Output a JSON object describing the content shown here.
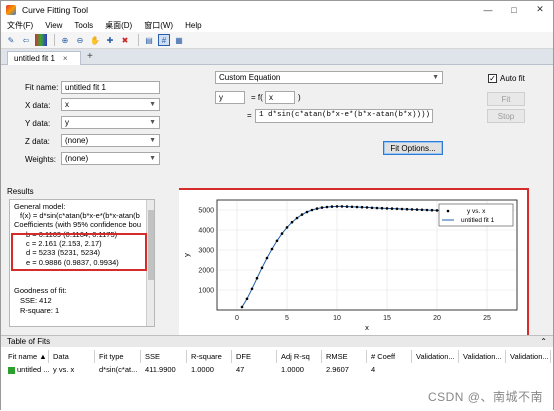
{
  "window": {
    "title": "Curve Fitting Tool",
    "minimize": "—",
    "maximize": "□",
    "close": "✕"
  },
  "menu": [
    "文件(F)",
    "View",
    "Tools",
    "桌面(D)",
    "窗口(W)",
    "Help"
  ],
  "tab": {
    "label": "untitled fit 1",
    "close": "×",
    "add": "+"
  },
  "fit_setup": {
    "fit_name_label": "Fit name:",
    "fit_name": "untitled fit 1",
    "x_label": "X data:",
    "x_value": "x",
    "y_label": "Y data:",
    "y_value": "y",
    "z_label": "Z data:",
    "z_value": "(none)",
    "weights_label": "Weights:",
    "weights_value": "(none)"
  },
  "equation": {
    "type": "Custom Equation",
    "lhs": "y",
    "eq": "= f(",
    "var": "x",
    "rparen": ")",
    "equals": "=",
    "expr": "1 d*sin(c*atan(b*x-e*(b*x-atan(b*x))))",
    "fit_options": "Fit Options..."
  },
  "auto_fit": {
    "label": "Auto fit",
    "checked": "✓"
  },
  "buttons": {
    "fit": "Fit",
    "stop": "Stop"
  },
  "results": {
    "header": "Results",
    "lines": [
      "General model:",
      "f(x) = d*sin(c*atan(b*x-e*(b*x-atan(b",
      "Coefficients (with 95% confidence bou",
      "b =      0.1169  (0.1164, 0.1175)",
      "c =      2.161  (2.153, 2.17)",
      "d =       5233  (5231, 5234)",
      "e =      0.9886  (0.9837, 0.9934)",
      "",
      "Goodness of fit:",
      "SSE: 412",
      "R-square: 1"
    ]
  },
  "chart_data": {
    "type": "line",
    "xlabel": "x",
    "ylabel": "y",
    "xlim": [
      -2,
      28
    ],
    "ylim": [
      0,
      5500
    ],
    "xticks": [
      0,
      5,
      10,
      15,
      20,
      25
    ],
    "yticks": [
      1000,
      2000,
      3000,
      4000,
      5000
    ],
    "legend": [
      "y vs. x",
      "untitled fit 1"
    ],
    "legend_position": "top-right",
    "grid": true,
    "series": [
      {
        "name": "y vs. x",
        "style": "points",
        "color": "#000000",
        "x": [
          0.5,
          1,
          1.5,
          2,
          2.5,
          3,
          3.5,
          4,
          4.5,
          5,
          5.5,
          6,
          6.5,
          7,
          7.5,
          8,
          8.5,
          9,
          9.5,
          10,
          10.5,
          11,
          11.5,
          12,
          12.5,
          13,
          13.5,
          14,
          14.5,
          15,
          15.5,
          16,
          16.5,
          17,
          17.5,
          18,
          18.5,
          19,
          19.5,
          20,
          20.5,
          21,
          21.5,
          22,
          22.5,
          23,
          23.5,
          24
        ],
        "y": [
          150,
          560,
          1060,
          1590,
          2110,
          2600,
          3050,
          3460,
          3820,
          4130,
          4390,
          4600,
          4770,
          4900,
          5000,
          5070,
          5120,
          5150,
          5170,
          5180,
          5180,
          5170,
          5160,
          5150,
          5140,
          5130,
          5110,
          5100,
          5090,
          5080,
          5070,
          5060,
          5050,
          5040,
          5030,
          5020,
          5010,
          5000,
          4990,
          4980,
          4970,
          4960,
          4950,
          4940,
          4930,
          4920,
          4910,
          4900
        ]
      },
      {
        "name": "untitled fit 1",
        "style": "line",
        "color": "#1f5fa8",
        "x": [
          0.5,
          1,
          1.5,
          2,
          2.5,
          3,
          3.5,
          4,
          4.5,
          5,
          5.5,
          6,
          6.5,
          7,
          7.5,
          8,
          8.5,
          9,
          9.5,
          10,
          10.5,
          11,
          11.5,
          12,
          12.5,
          13,
          13.5,
          14,
          14.5,
          15,
          15.5,
          16,
          16.5,
          17,
          17.5,
          18,
          18.5,
          19,
          19.5,
          20,
          20.5,
          21,
          21.5,
          22,
          22.5,
          23,
          23.5,
          24
        ],
        "y": [
          150,
          560,
          1060,
          1590,
          2110,
          2600,
          3050,
          3460,
          3820,
          4130,
          4390,
          4600,
          4770,
          4900,
          5000,
          5070,
          5120,
          5150,
          5170,
          5180,
          5180,
          5170,
          5160,
          5150,
          5140,
          5130,
          5110,
          5100,
          5090,
          5080,
          5070,
          5060,
          5050,
          5040,
          5030,
          5020,
          5010,
          5000,
          4990,
          4980,
          4970,
          4960,
          4950,
          4940,
          4930,
          4920,
          4910,
          4900
        ]
      }
    ]
  },
  "table": {
    "header": "Table of Fits",
    "columns": [
      "Fit name ▲",
      "Data",
      "Fit type",
      "SSE",
      "R-square",
      "DFE",
      "Adj R-sq",
      "RMSE",
      "# Coeff",
      "Validation...",
      "Validation...",
      "Validation..."
    ],
    "row": [
      "untitled ...",
      "y vs. x",
      "d*sin(c*at...",
      "411.9900",
      "1.0000",
      "47",
      "1.0000",
      "2.9607",
      "4",
      "",
      "",
      ""
    ]
  },
  "watermark": "CSDN @、南城不南"
}
